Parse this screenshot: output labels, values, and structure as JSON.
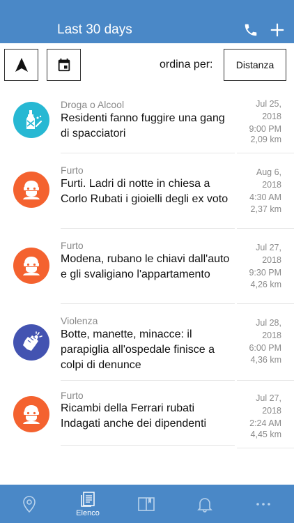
{
  "header": {
    "title": "Last 30 days",
    "actions": [
      {
        "icon": "phone-icon"
      },
      {
        "icon": "plus-icon"
      }
    ]
  },
  "toolbar": {
    "navigation_icon": "navigation-arrow-icon",
    "calendar_icon": "calendar-icon",
    "sort_label": "ordina per:",
    "sort_value": "Distanza"
  },
  "items": [
    {
      "category": "Droga o Alcool",
      "title": "Residenti fanno fuggire una gang di spacciatori",
      "date_line1": "Jul 25,",
      "date_line2": "2018",
      "time": "9:00 PM",
      "distance": "2,09 km",
      "icon": "drugs-alcohol-icon",
      "color": "#27b8d3"
    },
    {
      "category": "Furto",
      "title": "Furti. Ladri di notte in chiesa a Corlo Rubati i gioielli degli ex voto",
      "date_line1": "Aug 6,",
      "date_line2": "2018",
      "time": "4:30 AM",
      "distance": "2,37 km",
      "icon": "thief-icon",
      "color": "#f4622f"
    },
    {
      "category": "Furto",
      "title": "Modena, rubano le chiavi dall'auto e gli svaligiano l'appartamento",
      "date_line1": "Jul 27,",
      "date_line2": "2018",
      "time": "9:30 PM",
      "distance": "4,26 km",
      "icon": "thief-icon",
      "color": "#f4622f"
    },
    {
      "category": "Violenza",
      "title": "Botte, manette, minacce: il parapiglia all'ospedale finisce a colpi di denunce",
      "date_line1": "Jul 28,",
      "date_line2": "2018",
      "time": "6:00 PM",
      "distance": "4,36 km",
      "icon": "violence-fist-icon",
      "color": "#4353b1"
    },
    {
      "category": "Furto",
      "title": "Ricambi della Ferrari rubati Indagati anche dei dipendenti",
      "date_line1": "Jul 27,",
      "date_line2": "2018",
      "time": "2:24 AM",
      "distance": "4,45 km",
      "icon": "thief-icon",
      "color": "#f4622f"
    }
  ],
  "tabbar": {
    "tabs": [
      {
        "icon": "map-pin-icon",
        "label": ""
      },
      {
        "icon": "list-document-icon",
        "label": "Elenco"
      },
      {
        "icon": "book-icon",
        "label": ""
      },
      {
        "icon": "bell-icon",
        "label": ""
      },
      {
        "icon": "more-icon",
        "label": ""
      }
    ]
  }
}
